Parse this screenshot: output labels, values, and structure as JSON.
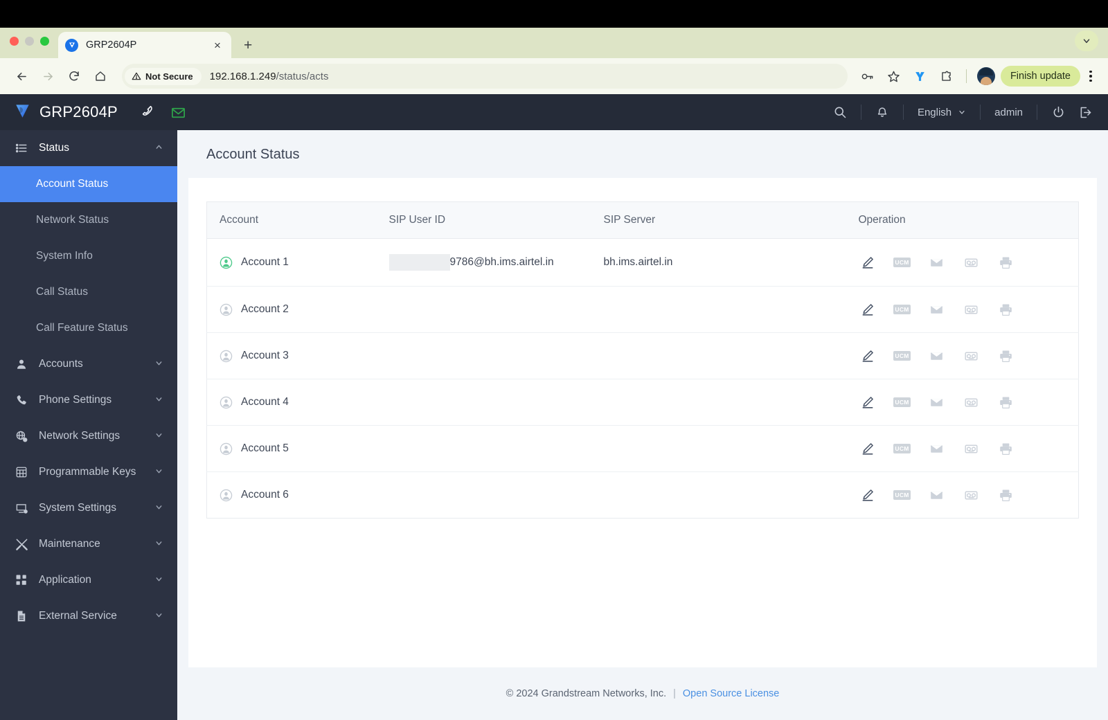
{
  "browser": {
    "tab": {
      "title": "GRP2604P",
      "favicon": "grandstream-logo-icon",
      "close_label": "×"
    },
    "new_tab_label": "+",
    "tabstrip_caret": "chevron-down-icon",
    "nav": {
      "back": "←",
      "forward": "→",
      "reload": "↻",
      "home": "home-icon"
    },
    "omnibox": {
      "security_label": "Not Secure",
      "url_host": "192.168.1.249",
      "url_path": "/status/acts",
      "full_url": "192.168.1.249/status/acts"
    },
    "actions": {
      "password_manager": "key-icon",
      "bookmark": "star-icon",
      "extension_y": "y-extension-icon",
      "extensions": "puzzle-icon",
      "profile": "avatar",
      "update_label": "Finish update",
      "menu": "kebab-menu-icon"
    }
  },
  "header": {
    "logo": "grandstream-logo-icon",
    "product": "GRP2604P",
    "phone_icon": "phone-handset-icon",
    "mail_icon": "envelope-icon",
    "search_icon": "search-icon",
    "bell_icon": "bell-icon",
    "language": "English",
    "language_caret": "chevron-down-icon",
    "user": "admin",
    "power_icon": "power-icon",
    "logout_icon": "logout-icon"
  },
  "sidebar": {
    "groups": [
      {
        "label": "Status",
        "icon": "list-icon",
        "caret": "chevron-up-icon",
        "open": true,
        "items": [
          {
            "label": "Account Status",
            "active": true
          },
          {
            "label": "Network Status",
            "active": false
          },
          {
            "label": "System Info",
            "active": false
          },
          {
            "label": "Call Status",
            "active": false
          },
          {
            "label": "Call Feature Status",
            "active": false
          }
        ]
      },
      {
        "label": "Accounts",
        "icon": "user-icon",
        "caret": "chevron-down-icon",
        "open": false,
        "items": []
      },
      {
        "label": "Phone Settings",
        "icon": "phone-icon",
        "caret": "chevron-down-icon",
        "open": false,
        "items": []
      },
      {
        "label": "Network Settings",
        "icon": "globe-gear-icon",
        "caret": "chevron-down-icon",
        "open": false,
        "items": []
      },
      {
        "label": "Programmable Keys",
        "icon": "keypad-icon",
        "caret": "chevron-down-icon",
        "open": false,
        "items": []
      },
      {
        "label": "System Settings",
        "icon": "monitor-gear-icon",
        "caret": "chevron-down-icon",
        "open": false,
        "items": []
      },
      {
        "label": "Maintenance",
        "icon": "tools-icon",
        "caret": "chevron-down-icon",
        "open": false,
        "items": []
      },
      {
        "label": "Application",
        "icon": "grid-icon",
        "caret": "chevron-down-icon",
        "open": false,
        "items": []
      },
      {
        "label": "External Service",
        "icon": "document-icon",
        "caret": "chevron-down-icon",
        "open": false,
        "items": []
      }
    ]
  },
  "main": {
    "page_title": "Account Status",
    "table": {
      "columns": [
        "Account",
        "SIP User ID",
        "SIP Server",
        "Operation"
      ],
      "rows": [
        {
          "account": "Account 1",
          "registered": true,
          "sip_user_id_redacted": true,
          "sip_user_id": "9786@bh.ims.airtel.in",
          "sip_server": "bh.ims.airtel.in"
        },
        {
          "account": "Account 2",
          "registered": false,
          "sip_user_id_redacted": false,
          "sip_user_id": "",
          "sip_server": ""
        },
        {
          "account": "Account 3",
          "registered": false,
          "sip_user_id_redacted": false,
          "sip_user_id": "",
          "sip_server": ""
        },
        {
          "account": "Account 4",
          "registered": false,
          "sip_user_id_redacted": false,
          "sip_user_id": "",
          "sip_server": ""
        },
        {
          "account": "Account 5",
          "registered": false,
          "sip_user_id_redacted": false,
          "sip_user_id": "",
          "sip_server": ""
        },
        {
          "account": "Account 6",
          "registered": false,
          "sip_user_id_redacted": false,
          "sip_user_id": "",
          "sip_server": ""
        }
      ],
      "operations": [
        {
          "name": "edit-pencil-icon",
          "label": "Edit",
          "enabled": true
        },
        {
          "name": "ucm-icon",
          "label": "UCM",
          "enabled": false
        },
        {
          "name": "envelope-icon",
          "label": "Message",
          "enabled": false
        },
        {
          "name": "voicemail-icon",
          "label": "Voicemail",
          "enabled": false
        },
        {
          "name": "printer-icon",
          "label": "Print",
          "enabled": false
        }
      ]
    }
  },
  "footer": {
    "copyright": "© 2024 Grandstream Networks, Inc.",
    "separator": "|",
    "link": "Open Source License"
  },
  "colors": {
    "sidebar_bg": "#2c3242",
    "header_bg": "#252b38",
    "active_item": "#4a86f0",
    "page_bg": "#f2f5f9",
    "registered_green": "#4cc98a",
    "link_blue": "#4a90e2",
    "browser_theme": "#dde4c6",
    "update_pill": "#d9ea9a"
  }
}
